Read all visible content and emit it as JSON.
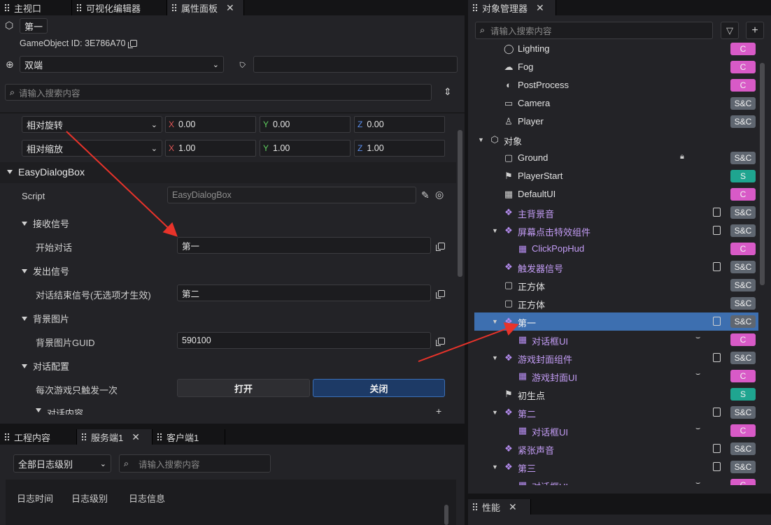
{
  "tabs_top_left": [
    "主视口",
    "可视化编辑器",
    "属性面板"
  ],
  "tabs_top_right": [
    "对象管理器"
  ],
  "tabs_bottom_left": [
    "工程内容",
    "服务端1",
    "客户端1"
  ],
  "tabs_bottom_right": [
    "性能"
  ],
  "props": {
    "object_name": "第一",
    "gameobject_id_label": "GameObject ID: 3E786A70",
    "net_mode": "双端",
    "tag_value": "",
    "search_placeholder": "请输入搜索内容",
    "rotation": {
      "label": "相对旋转",
      "x": "0.00",
      "y": "0.00",
      "z": "0.00"
    },
    "scale": {
      "label": "相对缩放",
      "x": "1.00",
      "y": "1.00",
      "z": "1.00"
    },
    "axis_x": "X",
    "axis_y": "Y",
    "axis_z": "Z",
    "component_title": "EasyDialogBox",
    "script_label": "Script",
    "script_value": "EasyDialogBox",
    "receive_section": "接收信号",
    "start_dialog_label": "开始对话",
    "start_dialog_value": "第一",
    "emit_section": "发出信号",
    "end_signal_label": "对话结束信号(无选项才生效)",
    "end_signal_value": "第二",
    "bg_section": "背景图片",
    "bg_guid_label": "背景图片GUID",
    "bg_guid_value": "590100",
    "config_section": "对话配置",
    "once_label": "每次游戏只触发一次",
    "on_label": "打开",
    "off_label": "关闭",
    "content_section": "对话内容"
  },
  "log": {
    "level_filter": "全部日志级别",
    "search_placeholder": "请输入搜索内容",
    "columns": [
      "日志时间",
      "日志级别",
      "日志信息"
    ]
  },
  "outliner": {
    "search_placeholder": "请输入搜索内容",
    "items": [
      {
        "name": "Lighting",
        "tag": "C"
      },
      {
        "name": "Fog",
        "tag": "C"
      },
      {
        "name": "PostProcess",
        "tag": "C"
      },
      {
        "name": "Camera",
        "tag": "S&C"
      },
      {
        "name": "Player",
        "tag": "S&C"
      },
      {
        "name": "对象",
        "tag": ""
      },
      {
        "name": "Ground",
        "tag": "S&C"
      },
      {
        "name": "PlayerStart",
        "tag": "S"
      },
      {
        "name": "DefaultUI",
        "tag": "C"
      },
      {
        "name": "主背景音",
        "tag": "S&C"
      },
      {
        "name": "屏幕点击特效组件",
        "tag": "S&C"
      },
      {
        "name": "ClickPopHud",
        "tag": "C"
      },
      {
        "name": "触发器信号",
        "tag": "S&C"
      },
      {
        "name": "正方体",
        "tag": "S&C"
      },
      {
        "name": "正方体",
        "tag": "S&C"
      },
      {
        "name": "第一",
        "tag": "S&C"
      },
      {
        "name": "对话框UI",
        "tag": "C"
      },
      {
        "name": "游戏封面组件",
        "tag": "S&C"
      },
      {
        "name": "游戏封面UI",
        "tag": "C"
      },
      {
        "name": "初生点",
        "tag": "S"
      },
      {
        "name": "第二",
        "tag": "S&C"
      },
      {
        "name": "对话框UI",
        "tag": "C"
      },
      {
        "name": "紧张声音",
        "tag": "S&C"
      },
      {
        "name": "第三",
        "tag": "S&C"
      },
      {
        "name": "对话框UI",
        "tag": "C"
      }
    ]
  },
  "colors": {
    "selected_row": "#3d6fb0",
    "arrow": "#e8332a",
    "tag_c": "#d85ac7",
    "tag_sc": "#5f6670",
    "tag_s": "#1fa590"
  }
}
